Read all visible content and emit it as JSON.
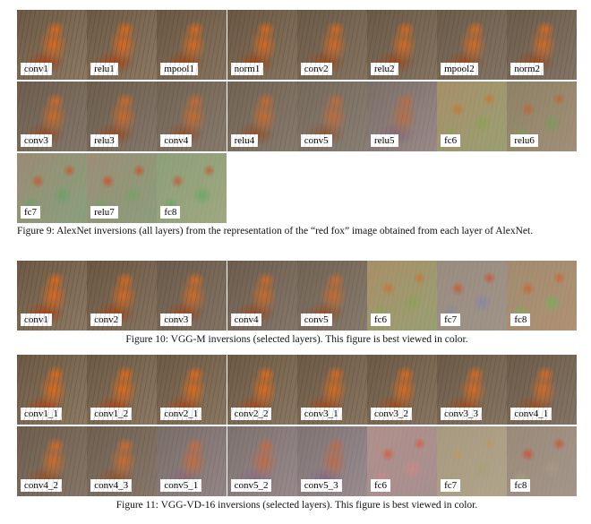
{
  "figure9": {
    "caption": "Figure 9: AlexNet inversions (all layers) from the representation of the “red fox” image obtained from each layer of AlexNet.",
    "labels": [
      "conv1",
      "relu1",
      "mpool1",
      "norm1",
      "conv2",
      "relu2",
      "mpool2",
      "norm2",
      "conv3",
      "relu3",
      "conv4",
      "relu4",
      "conv5",
      "relu5",
      "fc6",
      "relu6",
      "fc7",
      "relu7",
      "fc8"
    ]
  },
  "figure10": {
    "caption": "Figure 10: VGG-M inversions (selected layers). This figure is best viewed in color.",
    "labels": [
      "conv1",
      "conv2",
      "conv3",
      "conv4",
      "conv5",
      "fc6",
      "fc7",
      "fc8"
    ]
  },
  "figure11": {
    "caption": "Figure 11: VGG-VD-16 inversions (selected layers). This figure is best viewed in color.",
    "labels": [
      "conv1_1",
      "conv1_2",
      "conv2_1",
      "conv2_2",
      "conv3_1",
      "conv3_2",
      "conv3_3",
      "conv4_1",
      "conv4_2",
      "conv4_3",
      "conv5_1",
      "conv5_2",
      "conv5_3",
      "fc6",
      "fc7",
      "fc8"
    ]
  },
  "colors": {
    "fox_orange": "#d2691e",
    "fox_dark": "#8b3a10",
    "background_brown": "#6b5a45",
    "abstract_green": "#7fa36a",
    "abstract_pink": "#c88a8a"
  }
}
